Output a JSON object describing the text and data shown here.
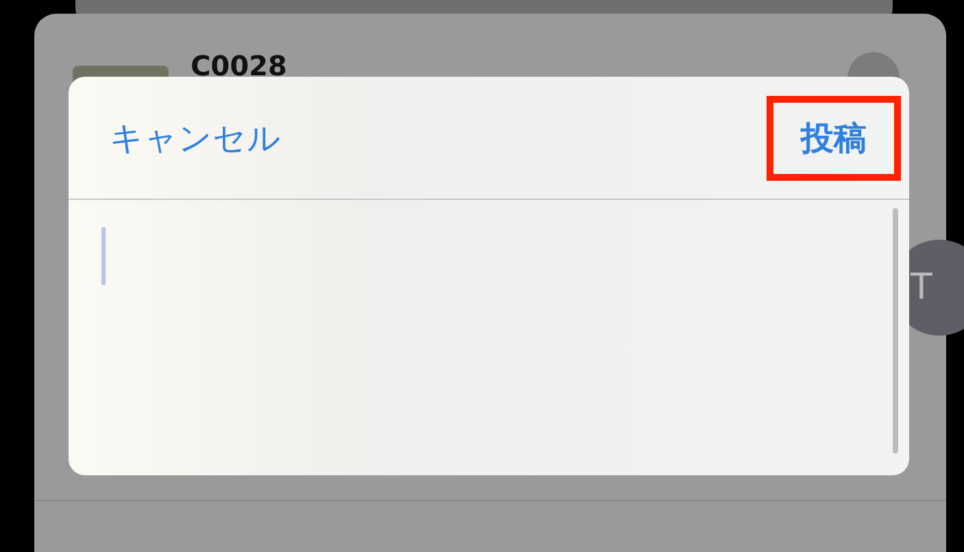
{
  "share_sheet": {
    "title": "C0028",
    "avatar_initial": "T"
  },
  "compose_dialog": {
    "cancel_label": "キャンセル",
    "post_label": "投稿",
    "post_highlighted": true
  }
}
